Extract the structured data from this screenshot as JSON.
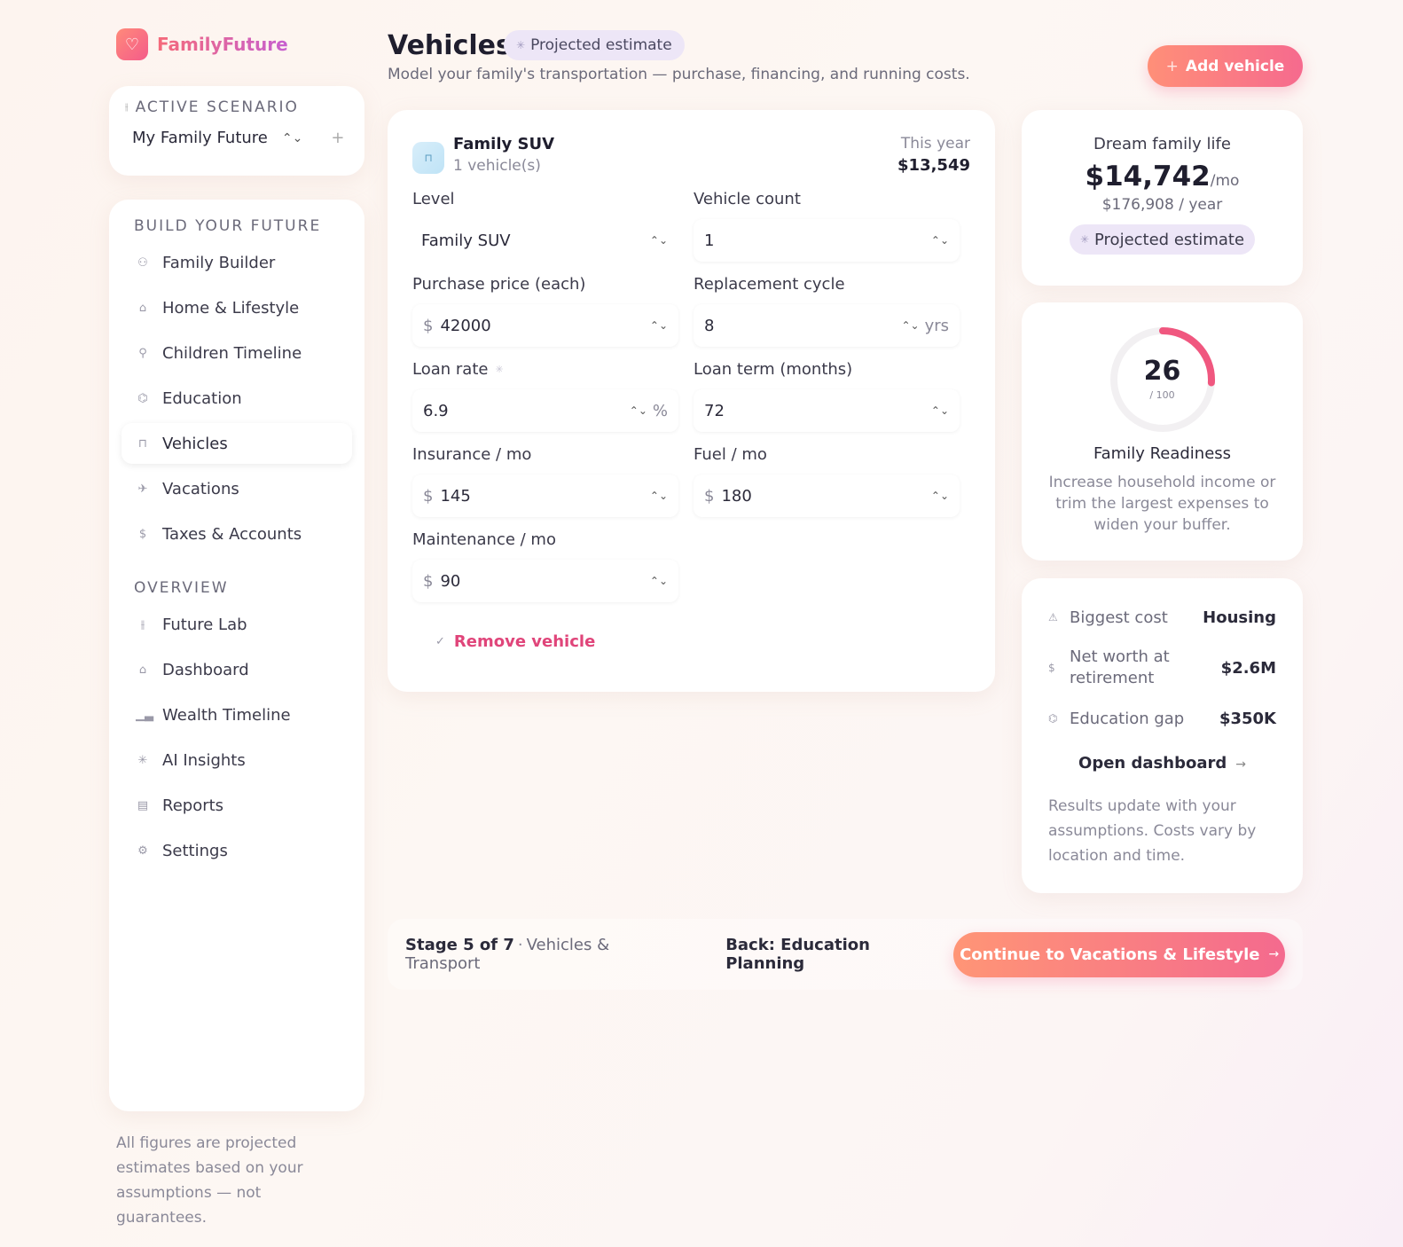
{
  "brand": {
    "name": "FamilyFuture",
    "logo_icon": "♡"
  },
  "scenario": {
    "label": "ACTIVE SCENARIO",
    "name": "My Family Future"
  },
  "sidebar": {
    "build_title": "BUILD YOUR FUTURE",
    "build_items": [
      {
        "label": "Family Builder",
        "icon": "people-icon",
        "glyph": "⚇"
      },
      {
        "label": "Home & Lifestyle",
        "icon": "home-icon",
        "glyph": "⌂"
      },
      {
        "label": "Children Timeline",
        "icon": "child-icon",
        "glyph": "⚲"
      },
      {
        "label": "Education",
        "icon": "graduation-cap-icon",
        "glyph": "⌬"
      },
      {
        "label": "Vehicles",
        "icon": "car-icon",
        "glyph": "⊓"
      },
      {
        "label": "Vacations",
        "icon": "plane-icon",
        "glyph": "✈"
      },
      {
        "label": "Taxes & Accounts",
        "icon": "dollar-icon",
        "glyph": "$"
      }
    ],
    "overview_title": "OVERVIEW",
    "overview_items": [
      {
        "label": "Future Lab",
        "icon": "sliders-icon",
        "glyph": "⫲"
      },
      {
        "label": "Dashboard",
        "icon": "house-icon",
        "glyph": "⌂"
      },
      {
        "label": "Wealth Timeline",
        "icon": "bar-chart-icon",
        "glyph": "▁▃"
      },
      {
        "label": "AI Insights",
        "icon": "sparkle-icon",
        "glyph": "✳"
      },
      {
        "label": "Reports",
        "icon": "document-icon",
        "glyph": "▤"
      },
      {
        "label": "Settings",
        "icon": "gear-icon",
        "glyph": "⚙"
      }
    ]
  },
  "disclaimer": "All figures are projected estimates based on your assumptions — not guarantees.",
  "header": {
    "title": "Vehicles",
    "badge": "Projected estimate",
    "subtitle": "Model your family's transportation — purchase, financing, and running costs.",
    "add_button": "Add vehicle"
  },
  "vehicle": {
    "name": "Family SUV",
    "count_text": "1 vehicle(s)",
    "year_label": "This year",
    "year_cost": "$13,549",
    "fields": {
      "level": {
        "label": "Level",
        "value": "Family SUV"
      },
      "vehicle_count": {
        "label": "Vehicle count",
        "value": "1"
      },
      "purchase_price": {
        "label": "Purchase price (each)",
        "prefix": "$",
        "value": "42000"
      },
      "replacement_cycle": {
        "label": "Replacement cycle",
        "value": "8",
        "unit": "yrs"
      },
      "loan_rate": {
        "label": "Loan rate",
        "value": "6.9",
        "unit": "%"
      },
      "loan_term": {
        "label": "Loan term (months)",
        "value": "72"
      },
      "insurance": {
        "label": "Insurance / mo",
        "prefix": "$",
        "value": "145"
      },
      "fuel": {
        "label": "Fuel / mo",
        "prefix": "$",
        "value": "180"
      },
      "maintenance": {
        "label": "Maintenance / mo",
        "prefix": "$",
        "value": "90"
      }
    },
    "remove_label": "Remove vehicle"
  },
  "dream": {
    "title": "Dream family life",
    "amount": "$14,742",
    "amount_suffix": "/mo",
    "yearly": "$176,908 / year",
    "badge": "Projected estimate"
  },
  "readiness": {
    "score": 26,
    "score_text": "26",
    "max_text": "/ 100",
    "title": "Family Readiness",
    "description": "Increase household income or trim the largest expenses to widen your buffer.",
    "ring_color": "#f0577f",
    "track_color": "#f2f0f2"
  },
  "stats": {
    "rows": [
      {
        "label": "Biggest cost",
        "value": "Housing",
        "icon": "warning-icon"
      },
      {
        "label": "Net worth at retirement",
        "value": "$2.6M",
        "icon": "dollar-icon"
      },
      {
        "label": "Education gap",
        "value": "$350K",
        "icon": "graduation-cap-icon"
      }
    ],
    "open_dashboard": "Open dashboard",
    "note": "Results update with your assumptions. Costs vary by location and time."
  },
  "footer": {
    "stage": "Stage 5 of 7",
    "stage_sub": "Vehicles & Transport",
    "back": "Back: Education Planning",
    "continue": "Continue to Vacations & Lifestyle"
  },
  "colors": {
    "accent": "#f66a8e",
    "accent_orange": "#ff8f78",
    "badge_bg": "#ede6f7"
  }
}
